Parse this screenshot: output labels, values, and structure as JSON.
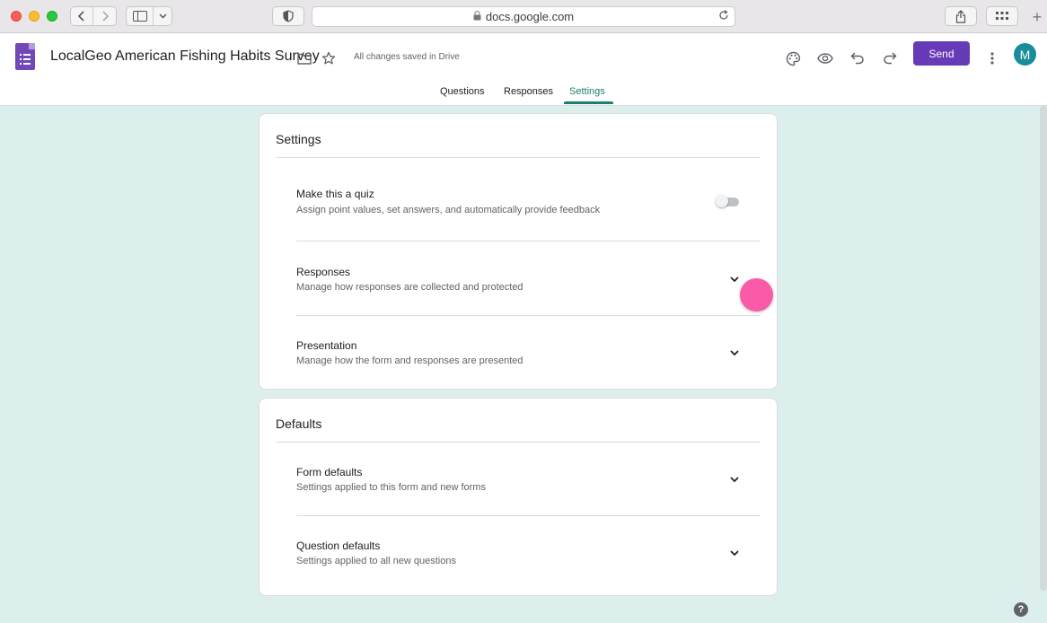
{
  "browser": {
    "url": "docs.google.com"
  },
  "header": {
    "title": "LocalGeo American Fishing Habits Survey",
    "saved_status": "All changes saved in Drive",
    "send_label": "Send",
    "avatar_initial": "M",
    "accent_color": "#673ab7",
    "icons": [
      "folder-icon",
      "star-icon",
      "palette-icon",
      "preview-eye-icon",
      "undo-icon",
      "redo-icon",
      "more-vert-icon"
    ]
  },
  "tabs": [
    {
      "label": "Questions",
      "active": false
    },
    {
      "label": "Responses",
      "active": false
    },
    {
      "label": "Settings",
      "active": true
    }
  ],
  "settings_card": {
    "title": "Settings",
    "rows": [
      {
        "title": "Make this a quiz",
        "subtitle": "Assign point values, set answers, and automatically provide feedback",
        "control": "toggle",
        "toggle_on": false
      },
      {
        "title": "Responses",
        "subtitle": "Manage how responses are collected and protected",
        "control": "chevron-down-icon"
      },
      {
        "title": "Presentation",
        "subtitle": "Manage how the form and responses are presented",
        "control": "chevron-down-icon"
      }
    ]
  },
  "defaults_card": {
    "title": "Defaults",
    "rows": [
      {
        "title": "Form defaults",
        "subtitle": "Settings applied to this form and new forms",
        "control": "chevron-down-icon"
      },
      {
        "title": "Question defaults",
        "subtitle": "Settings applied to all new questions",
        "control": "chevron-down-icon"
      }
    ]
  },
  "help_label": "?"
}
